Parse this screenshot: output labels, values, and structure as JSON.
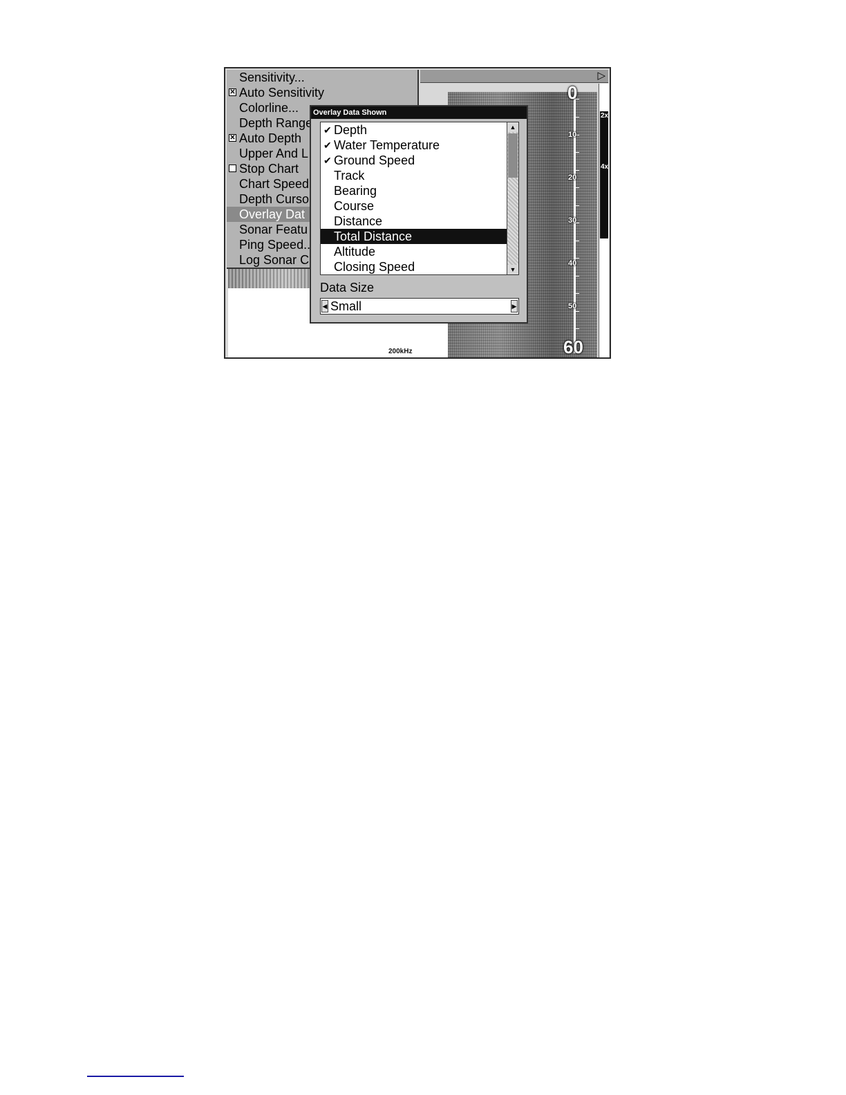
{
  "screen": {
    "frequency_label": "200kHz",
    "depth_scale": [
      "0",
      "10",
      "20",
      "30",
      "40",
      "50",
      "60"
    ],
    "zoom_labels": [
      "2x",
      "4x"
    ]
  },
  "main_menu": {
    "items": [
      {
        "label": "Sensitivity...",
        "checkbox": null
      },
      {
        "label": "Auto Sensitivity",
        "checkbox": "checked"
      },
      {
        "label": "Colorline...",
        "checkbox": null
      },
      {
        "label": "Depth Range",
        "checkbox": null
      },
      {
        "label": "Auto Depth",
        "checkbox": "checked"
      },
      {
        "label": "Upper And L",
        "checkbox": null
      },
      {
        "label": "Stop Chart",
        "checkbox": "unchecked"
      },
      {
        "label": "Chart Speed",
        "checkbox": null
      },
      {
        "label": "Depth Curso",
        "checkbox": null
      },
      {
        "label": "Overlay Dat",
        "checkbox": null,
        "selected": true
      },
      {
        "label": "Sonar Featu",
        "checkbox": null
      },
      {
        "label": "Ping Speed..",
        "checkbox": null
      },
      {
        "label": "Log Sonar C",
        "checkbox": null
      }
    ]
  },
  "dialog": {
    "title": "Overlay Data Shown",
    "items": [
      {
        "label": "Depth",
        "checked": true
      },
      {
        "label": "Water Temperature",
        "checked": true
      },
      {
        "label": "Ground Speed",
        "checked": true
      },
      {
        "label": "Track",
        "checked": false
      },
      {
        "label": "Bearing",
        "checked": false
      },
      {
        "label": "Course",
        "checked": false
      },
      {
        "label": "Distance",
        "checked": false
      },
      {
        "label": "Total Distance",
        "checked": false,
        "selected": true
      },
      {
        "label": "Altitude",
        "checked": false
      },
      {
        "label": "Closing Speed",
        "checked": false
      }
    ],
    "size_label": "Data Size",
    "size_value": "Small"
  },
  "icons": {
    "play": "play-icon",
    "check": "checkmark-icon",
    "x_check": "x-checkbox-icon",
    "scroll_up": "scroll-up-icon",
    "scroll_down": "scroll-down-icon",
    "left": "arrow-left-icon",
    "right": "arrow-right-icon"
  }
}
